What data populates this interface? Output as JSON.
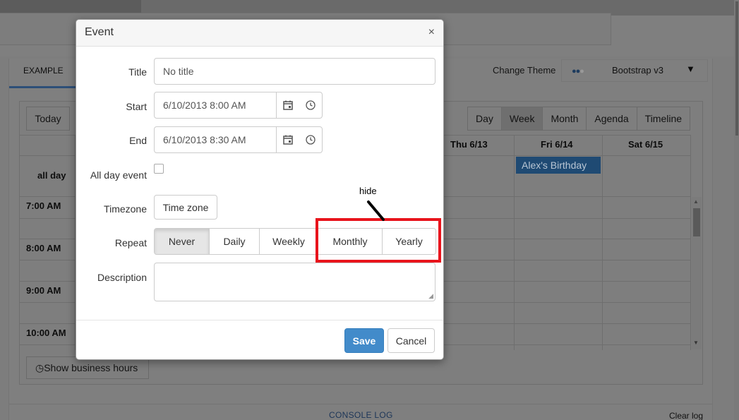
{
  "background": {
    "tab_example": "EXAMPLE",
    "change_theme_label": "Change Theme",
    "theme_value": "Bootstrap v3",
    "today_button": "Today",
    "views": [
      "Day",
      "Week",
      "Month",
      "Agenda",
      "Timeline"
    ],
    "active_view": "Week",
    "days": [
      "Thu 6/13",
      "Fri 6/14",
      "Sat 6/15"
    ],
    "all_day_label": "all day",
    "event_title": "Alex's Birthday",
    "times": [
      "7:00 AM",
      "8:00 AM",
      "9:00 AM",
      "10:00 AM"
    ],
    "business_hours_button": "Show business hours",
    "console_log": "CONSOLE LOG",
    "clear_log": "Clear log"
  },
  "modal": {
    "title": "Event",
    "close_symbol": "×",
    "labels": {
      "title": "Title",
      "start": "Start",
      "end": "End",
      "all_day": "All day event",
      "timezone": "Timezone",
      "repeat": "Repeat",
      "description": "Description"
    },
    "title_value": "No title",
    "start_value": "6/10/2013 8:00 AM",
    "end_value": "6/10/2013 8:30 AM",
    "all_day_checked": false,
    "timezone_button": "Time zone",
    "repeat_options": [
      "Never",
      "Daily",
      "Weekly",
      "Monthly",
      "Yearly"
    ],
    "repeat_selected": "Never",
    "description_value": "",
    "save_button": "Save",
    "cancel_button": "Cancel"
  },
  "annotation": {
    "text": "hide",
    "color": "#e8141c"
  },
  "colors": {
    "primary": "#428bca",
    "event_bg": "#1f4a73"
  }
}
